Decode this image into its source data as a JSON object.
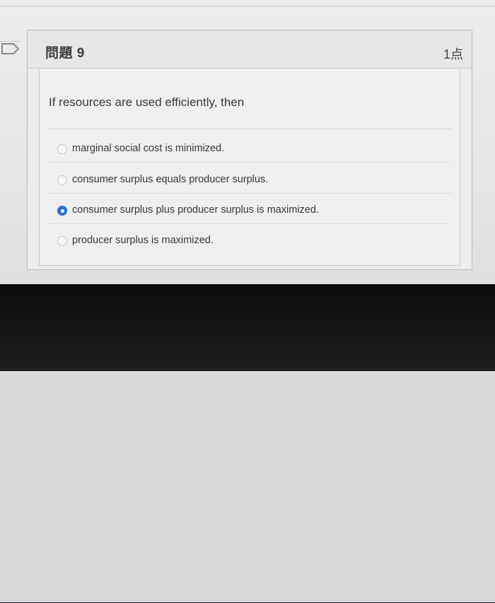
{
  "question": {
    "title": "問題 9",
    "points": "1点",
    "text": "If resources are used efficiently, then"
  },
  "answers": [
    {
      "label": "marginal social cost is minimized.",
      "selected": false
    },
    {
      "label": "consumer surplus equals producer surplus.",
      "selected": false
    },
    {
      "label": "consumer surplus plus producer surplus is maximized.",
      "selected": true
    },
    {
      "label": "producer surplus is maximized.",
      "selected": false
    }
  ],
  "icons": {
    "flag": "flag-outline-icon"
  },
  "colors": {
    "radio_selected": "#2b6fd6",
    "text": "#3a3a3a",
    "card_background": "#ececec",
    "border": "#bdbdbd"
  }
}
